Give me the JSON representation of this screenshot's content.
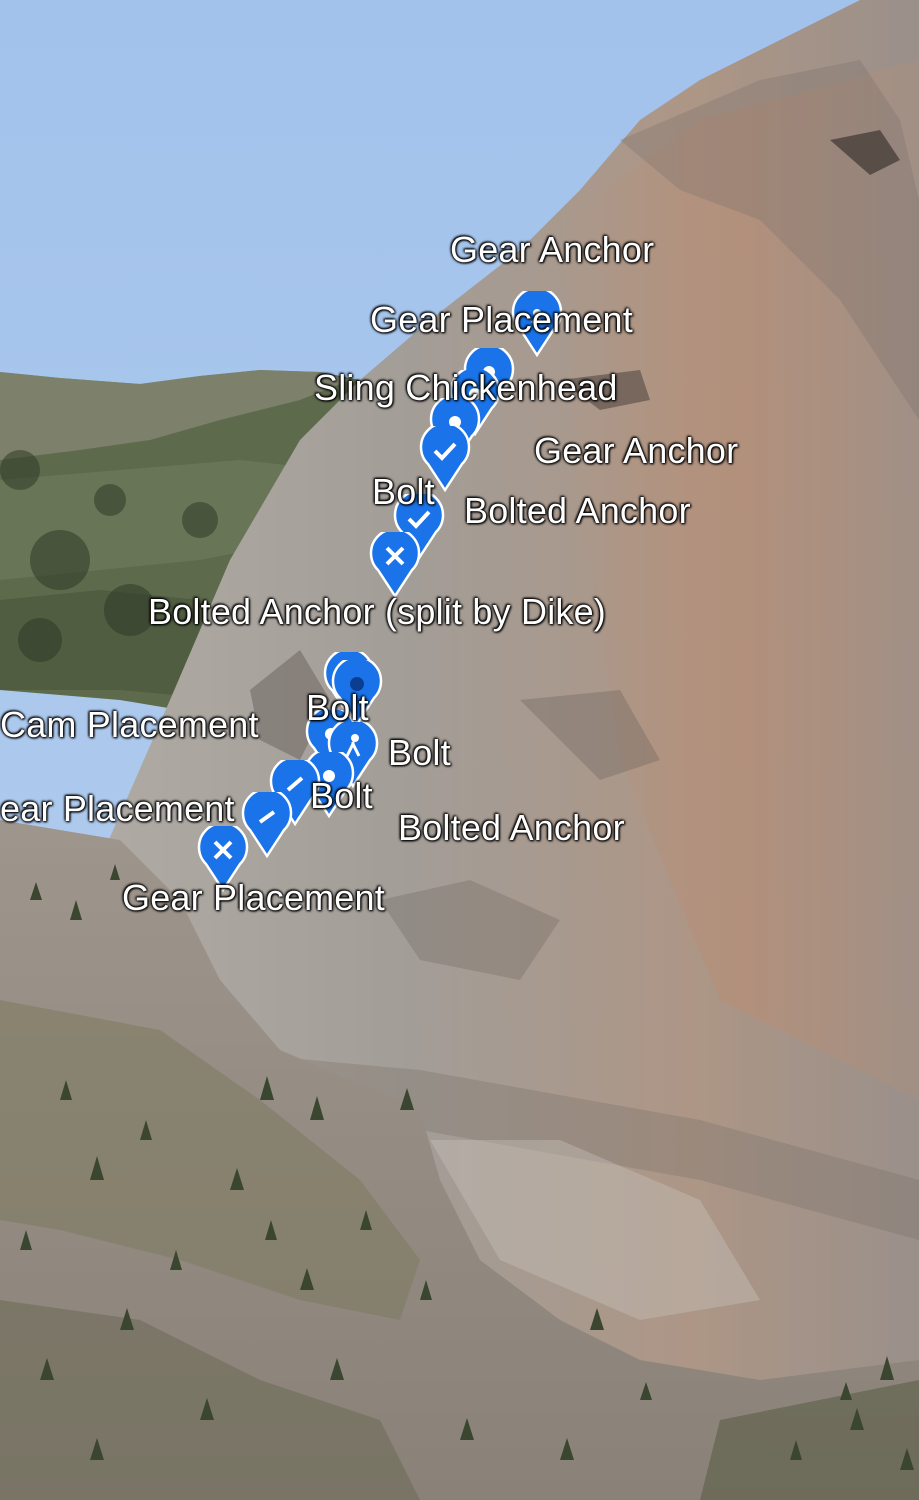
{
  "map": {
    "colors": {
      "sky": "#a9c8ec",
      "rock": "#9c958f",
      "rock_light": "#b9b3ac",
      "rock_stain": "#b98d73",
      "forest": "#4d5a3c",
      "pin": "#1a73e8",
      "label_text": "#ffffff"
    },
    "placemarks": [
      {
        "id": "p1",
        "label": "Gear Anchor",
        "icon": "climber-icon"
      },
      {
        "id": "p2",
        "label": "Gear Placement",
        "icon": "pin-icon"
      },
      {
        "id": "p3",
        "label": "Sling Chickenhead",
        "icon": "pin-icon"
      },
      {
        "id": "p4",
        "label": "Gear Anchor",
        "icon": "check-icon"
      },
      {
        "id": "p5",
        "label": "Bolt",
        "icon": "check-icon"
      },
      {
        "id": "p6",
        "label": "Bolted Anchor",
        "icon": "check-icon"
      },
      {
        "id": "p7",
        "label": "Bolted Anchor (split by Dike)",
        "icon": "close-icon"
      },
      {
        "id": "p8",
        "label": "Bolt",
        "icon": "dot-icon"
      },
      {
        "id": "p9",
        "label": "Cam Placement",
        "icon": "pin-icon"
      },
      {
        "id": "p10",
        "label": "Bolt",
        "icon": "climber-icon"
      },
      {
        "id": "p11",
        "label": "Bolt",
        "icon": "pin-icon"
      },
      {
        "id": "p12",
        "label": "ear Placement",
        "icon": "minus-icon"
      },
      {
        "id": "p13",
        "label": "Bolted Anchor",
        "icon": "pin-icon"
      },
      {
        "id": "p14",
        "label": "Gear Placement",
        "icon": "close-icon"
      }
    ]
  }
}
